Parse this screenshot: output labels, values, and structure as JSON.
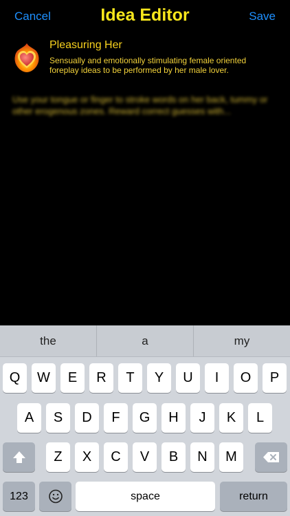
{
  "nav": {
    "cancel": "Cancel",
    "title": "Idea Editor",
    "save": "Save"
  },
  "category": {
    "icon": "flaming-heart-icon",
    "title": "Pleasuring Her",
    "description": "Sensually and emotionally stimulating female oriented foreplay ideas to be performed by her male lover."
  },
  "editor": {
    "text": "Use your tongue or finger to stroke words on her back, tummy or other erogenous zones. Reward correct guesses with..."
  },
  "keyboard": {
    "suggestions": [
      "the",
      "a",
      "my"
    ],
    "row1": [
      "Q",
      "W",
      "E",
      "R",
      "T",
      "Y",
      "U",
      "I",
      "O",
      "P"
    ],
    "row2": [
      "A",
      "S",
      "D",
      "F",
      "G",
      "H",
      "J",
      "K",
      "L"
    ],
    "row3": [
      "Z",
      "X",
      "C",
      "V",
      "B",
      "N",
      "M"
    ],
    "numbers_label": "123",
    "space_label": "space",
    "return_label": "return",
    "shift_icon": "shift-icon",
    "delete_icon": "backspace-icon",
    "emoji_icon": "emoji-icon"
  }
}
